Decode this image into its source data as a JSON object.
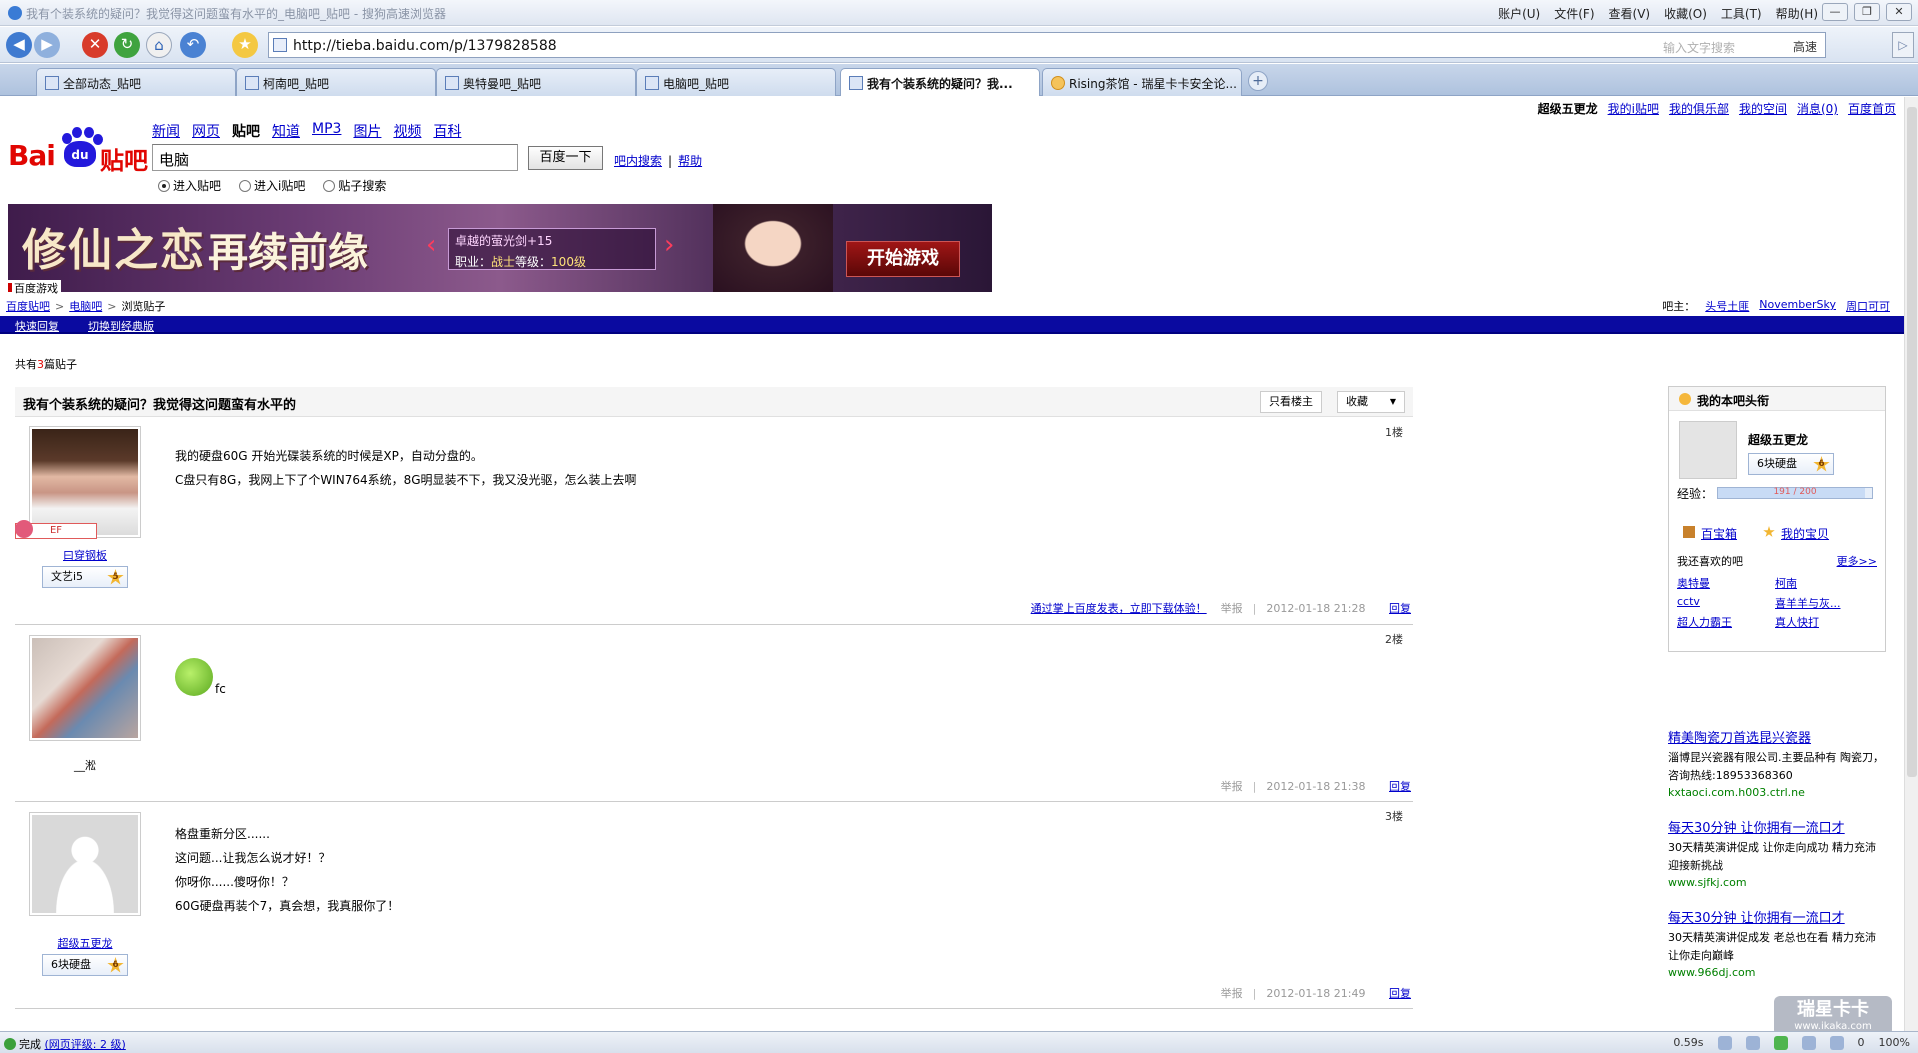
{
  "window": {
    "title": "我有个装系统的疑问？我觉得这问题蛮有水平的_电脑吧_贴吧 - 搜狗高速浏览器",
    "menus": [
      "账户(U)",
      "文件(F)",
      "查看(V)",
      "收藏(O)",
      "工具(T)",
      "帮助(H)"
    ]
  },
  "address": {
    "url": "http://tieba.baidu.com/p/1379828588",
    "search_placeholder": "输入文字搜索",
    "speed_label": "高速"
  },
  "tabs": [
    {
      "label": "全部动态_贴吧",
      "active": false
    },
    {
      "label": "柯南吧_贴吧",
      "active": false
    },
    {
      "label": "奥特曼吧_贴吧",
      "active": false
    },
    {
      "label": "电脑吧_贴吧",
      "active": false
    },
    {
      "label": "我有个装系统的疑问？我...",
      "active": true
    },
    {
      "label": "Rising茶馆 - 瑞星卡卡安全论...",
      "active": false
    }
  ],
  "userbar": {
    "username": "超级五更龙",
    "links": [
      "我的i贴吧",
      "我的俱乐部",
      "我的空间",
      "消息(0)",
      "百度首页"
    ]
  },
  "logo": {
    "bai": "Bai",
    "du": "du",
    "tieba": "贴吧"
  },
  "topnav": [
    "新闻",
    "网页",
    "贴吧",
    "知道",
    "MP3",
    "图片",
    "视频",
    "百科"
  ],
  "topnav_current": "贴吧",
  "search": {
    "value": "电脑",
    "button": "百度一下",
    "link_search": "吧内搜索",
    "link_help": "帮助",
    "sep": "|",
    "radios": [
      {
        "label": "进入贴吧",
        "checked": true
      },
      {
        "label": "进入i贴吧",
        "checked": false
      },
      {
        "label": "贴子搜索",
        "checked": false
      }
    ]
  },
  "banner": {
    "headline_a": "修仙之恋",
    "headline_b": "再续前缘",
    "item_name": "卓越的萤光剑+15",
    "item_job_label": "职业：",
    "item_job": "战士",
    "item_level_label": "等级：",
    "item_level": "100级",
    "play_button": "开始游戏",
    "ad_tag": "百度游戏"
  },
  "breadcrumb": [
    "百度贴吧",
    "电脑吧",
    "浏览贴子"
  ],
  "admins": {
    "label": "吧主：",
    "names": [
      "头号土匪",
      "NovemberSky",
      "周口可可"
    ]
  },
  "bluebar": {
    "quick_reply": "快速回复",
    "switch_classic": "切换到经典版"
  },
  "post_count": {
    "prefix": "共有",
    "num": "3",
    "suffix": "篇贴子"
  },
  "thread": {
    "title": "我有个装系统的疑问？我觉得这问题蛮有水平的",
    "only_op": "只看楼主",
    "collect": "收藏"
  },
  "posts": [
    {
      "floor": "1楼",
      "user": "曰穿钢板",
      "avatar_tag": "EF",
      "badge": "文艺i5",
      "level": "5",
      "lines": [
        "我的硬盘60G 开始光碟装系统的时候是XP，自动分盘的。",
        "C盘只有8G，我网上下了个WIN764系统，8G明显装不下，我又没光驱，怎么装上去啊"
      ],
      "promo": "通过掌上百度发表，立即下载体验！",
      "report": "举报",
      "time": "2012-01-18 21:28",
      "reply": "回复"
    },
    {
      "floor": "2楼",
      "user": "__淞",
      "badge": "",
      "level": "",
      "lines": [
        "fc"
      ],
      "report": "举报",
      "time": "2012-01-18 21:38",
      "reply": "回复"
    },
    {
      "floor": "3楼",
      "user": "超级五更龙",
      "badge": "6块硬盘",
      "level": "6",
      "lines": [
        "格盘重新分区......",
        "这问题...让我怎么说才好！？",
        "你呀你......傻呀你！？",
        "60G硬盘再装个7，真会想，我真服你了！"
      ],
      "report": "举报",
      "time": "2012-01-18 21:49",
      "reply": "回复"
    }
  ],
  "mybox": {
    "title": "我的本吧头衔",
    "name": "超级五更龙",
    "badge": "6块硬盘",
    "level": "6",
    "exp_label": "经验：",
    "exp_text": "191 / 200",
    "exp_fraction": 0.955,
    "treasure": "百宝箱",
    "baby": "我的宝贝",
    "like_title": "我还喜欢的吧",
    "more": "更多>>",
    "liked": [
      "奥特曼",
      "柯南",
      "cctv",
      "喜羊羊与灰...",
      "超人力霸王",
      "真人快打"
    ]
  },
  "ads": [
    {
      "title": "精美陶瓷刀首选昆兴瓷器",
      "desc": "淄博昆兴瓷器有限公司.主要品种有 陶瓷刀，咨询热线:18953368360",
      "url": "kxtaoci.com.h003.ctrl.ne"
    },
    {
      "title": "每天30分钟 让你拥有一流口才",
      "desc": "30天精英演讲促成 让你走向成功 精力充沛 迎接新挑战",
      "url": "www.sjfkj.com"
    },
    {
      "title": "每天30分钟 让你拥有一流口才",
      "desc": "30天精英演讲促成发 老总也在看 精力充沛 让你走向巅峰",
      "url": "www.966dj.com"
    }
  ],
  "status": {
    "done": "完成",
    "rating": "(网页评级: 2 级)",
    "time": "0.59s",
    "counter": "0",
    "zoom": "100%"
  },
  "watermark": {
    "main": "瑞星卡卡",
    "sub": "www.ikaka.com"
  },
  "colors": {
    "tieba_red": "#e10602",
    "link_blue": "#0000cc",
    "bar_blue": "#0a0aa0",
    "ad_green": "#008000"
  }
}
